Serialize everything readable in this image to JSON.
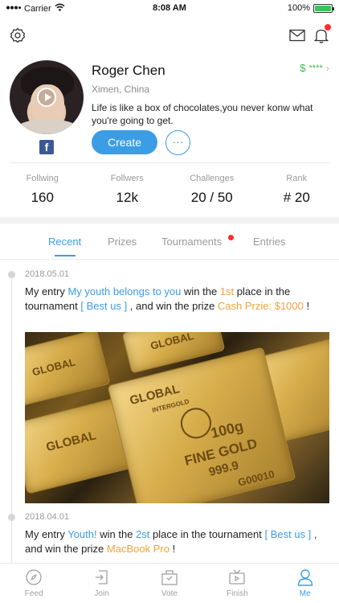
{
  "status_bar": {
    "carrier": "Carrier",
    "time": "8:08 AM",
    "battery": "100%"
  },
  "header": {
    "settings_icon": "gear-icon",
    "mail_icon": "mail-icon",
    "bell_icon": "bell-icon"
  },
  "profile": {
    "name": "Roger Chen",
    "location": "Ximen, China",
    "bio": "Life is like a box of chocolates,you never konw what you're going to get.",
    "wallet_symbol": "$",
    "wallet_value": "****",
    "create_label": "Create",
    "more_label": "···"
  },
  "stats": [
    {
      "label": "Follwing",
      "value": "160"
    },
    {
      "label": "Follwers",
      "value": "12k"
    },
    {
      "label": "Challenges",
      "value": "20 / 50"
    },
    {
      "label": "Rank",
      "value": "# 20"
    }
  ],
  "tabs": [
    {
      "label": "Recent"
    },
    {
      "label": "Prizes"
    },
    {
      "label": "Tournaments"
    },
    {
      "label": "Entries"
    }
  ],
  "entries": [
    {
      "date": "2018.05.01",
      "p1": "My entry ",
      "entry": "My youth belongs to you",
      "p2": " win the ",
      "place": "1st",
      "p3": " place in the tournament ",
      "tournament": "[ Best us ]",
      "p4": " , and win the prize ",
      "prize": "Cash Przie: $1000",
      "p5": " !"
    },
    {
      "date": "2018.04.01",
      "p1": "My entry ",
      "entry": "Youth!",
      "p2": " win the ",
      "place": "2st",
      "p3": " place in the tournament ",
      "tournament": "[ Best us ]",
      "p4": " , and win the prize ",
      "prize": "MacBook Pro",
      "p5": " !"
    }
  ],
  "photo": {
    "bar_texts": [
      "GLOBAL",
      "INTERGOLD",
      "100g",
      "FINE GOLD",
      "999.9",
      "G00010",
      "GLOBAL",
      "GLOBAL",
      "GLOBAL"
    ]
  },
  "bottom_nav": [
    {
      "label": "Feed",
      "icon": "compass-icon"
    },
    {
      "label": "Join",
      "icon": "join-icon"
    },
    {
      "label": "Vote",
      "icon": "vote-icon"
    },
    {
      "label": "Finish",
      "icon": "tv-icon"
    },
    {
      "label": "Me",
      "icon": "person-icon"
    }
  ],
  "colors": {
    "accent": "#3b9de6",
    "prize": "#f2a33a",
    "wallet": "#3cba4a",
    "badge": "#ff2d2d"
  }
}
